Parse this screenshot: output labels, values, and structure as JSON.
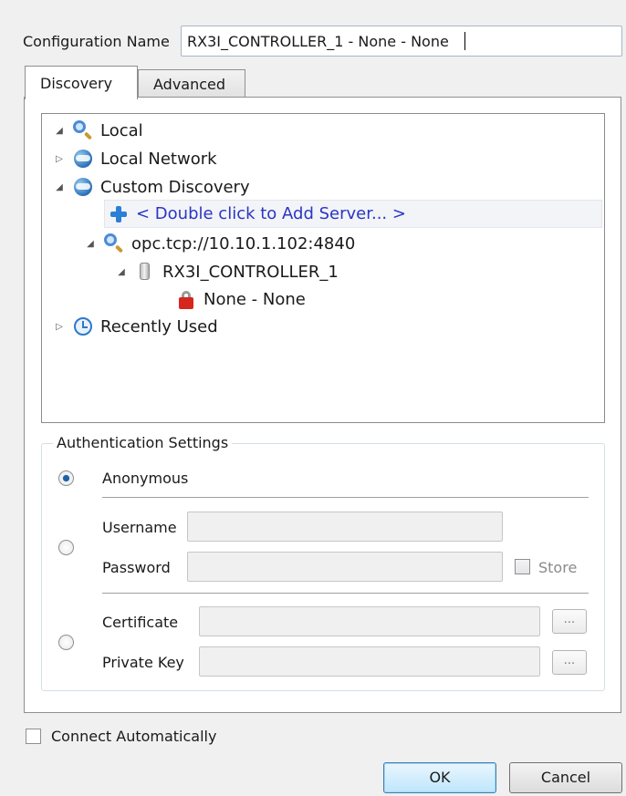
{
  "config": {
    "label": "Configuration Name",
    "value": "RX3I_CONTROLLER_1 - None - None"
  },
  "tabs": [
    {
      "label": "Discovery",
      "active": true
    },
    {
      "label": "Advanced",
      "active": false
    }
  ],
  "tree": {
    "local": "Local",
    "local_network": "Local Network",
    "custom_discovery": "Custom Discovery",
    "add_server": "< Double click to Add Server... >",
    "endpoint": "opc.tcp://10.10.1.102:4840",
    "server": "RX3I_CONTROLLER_1",
    "security": "None - None",
    "recently_used": "Recently Used"
  },
  "auth": {
    "title": "Authentication Settings",
    "anonymous": "Anonymous",
    "username": "Username",
    "password": "Password",
    "store": "Store",
    "certificate": "Certificate",
    "private_key": "Private Key",
    "browse": "...",
    "selected": "anonymous"
  },
  "connect_auto": "Connect Automatically",
  "buttons": {
    "ok": "OK",
    "cancel": "Cancel"
  },
  "colors": {
    "link": "#2b35c4",
    "default_button": "#bee6fd"
  }
}
